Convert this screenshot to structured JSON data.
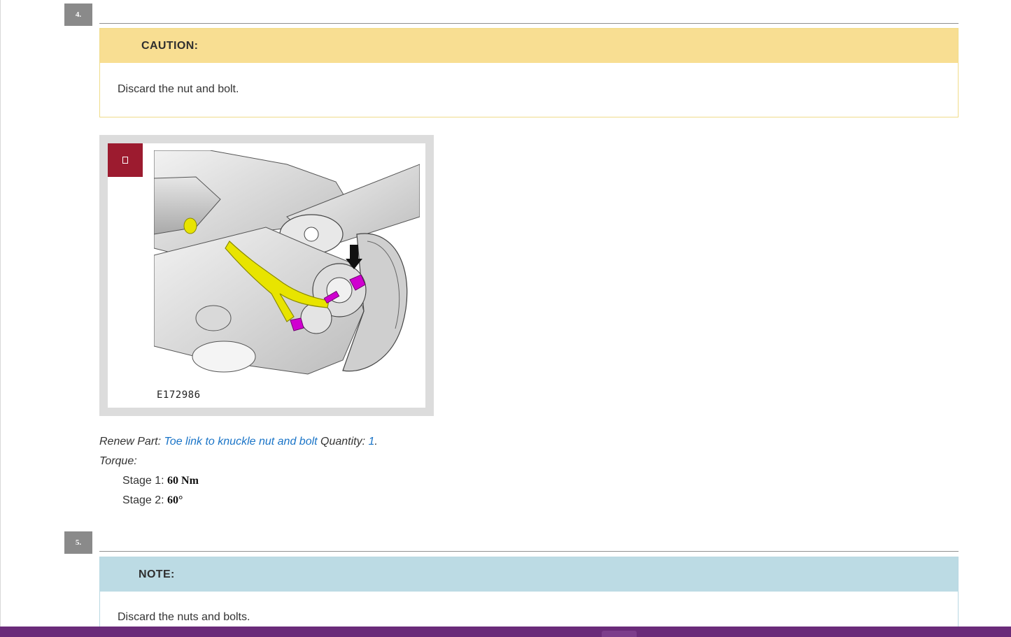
{
  "steps": [
    {
      "number": "4.",
      "caution": {
        "heading": "CAUTION:",
        "text": "Discard the nut and bolt."
      },
      "figure": {
        "code": "E172986",
        "zoom_icon": "zoom-icon"
      },
      "renew_part": {
        "prefix": "Renew Part: ",
        "part_link": "Toe link to knuckle nut and bolt",
        "quantity_label": " Quantity: ",
        "quantity_value": "1",
        "suffix": "."
      },
      "torque": {
        "label": "Torque:",
        "stages": [
          {
            "label": "Stage 1: ",
            "value": "60 Nm"
          },
          {
            "label": "Stage 2: ",
            "value": "60°"
          }
        ]
      }
    },
    {
      "number": "5.",
      "note": {
        "heading": "NOTE:",
        "text": "Discard the nuts and bolts."
      }
    }
  ],
  "colors": {
    "caution_header": "#f8de92",
    "note_header": "#bcdbe4",
    "link": "#1a74c7",
    "zoom_button": "#9c1b2f",
    "bottom_bar": "#6a2b79"
  }
}
